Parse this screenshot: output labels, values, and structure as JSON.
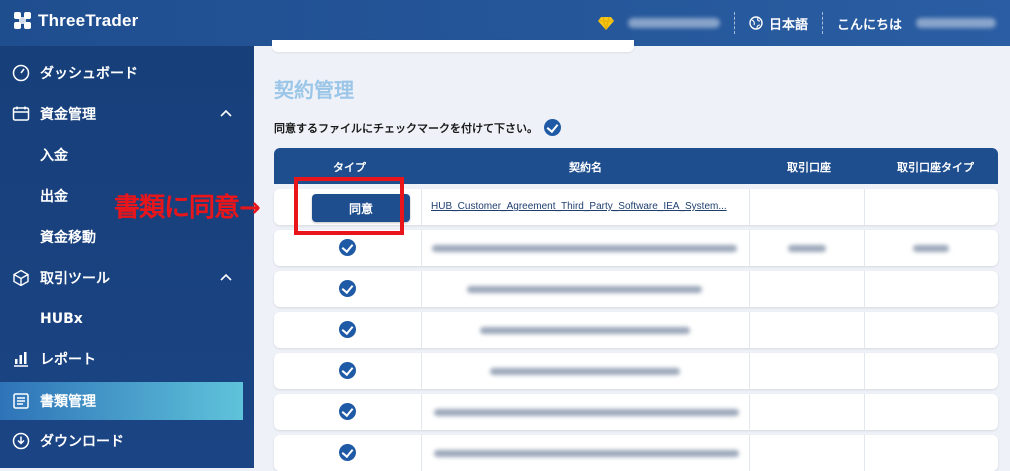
{
  "header": {
    "brand": "ThreeTrader",
    "language": "日本語",
    "greeting": "こんにちは"
  },
  "sidebar": {
    "items": [
      {
        "label": "ダッシュボード",
        "icon": "gauge-icon"
      },
      {
        "label": "資金管理",
        "icon": "wallet-icon",
        "expanded": true
      },
      {
        "label": "入金",
        "sub": true
      },
      {
        "label": "出金",
        "sub": true
      },
      {
        "label": "資金移動",
        "sub": true
      },
      {
        "label": "取引ツール",
        "icon": "cube-icon",
        "expanded": true
      },
      {
        "label": "HUBx",
        "sub": true
      },
      {
        "label": "レポート",
        "icon": "report-icon"
      },
      {
        "label": "書類管理",
        "icon": "document-icon",
        "active": true
      },
      {
        "label": "ダウンロード",
        "icon": "download-icon"
      }
    ]
  },
  "main": {
    "title": "契約管理",
    "instruction": "同意するファイルにチェックマークを付けて下さい。",
    "table": {
      "headers": [
        "タイプ",
        "契約名",
        "取引口座",
        "取引口座タイプ"
      ],
      "first_row": {
        "button": "同意",
        "doc": "HUB_Customer_Agreement_Third_Party_Software_IEA_System..."
      }
    },
    "annotation": "書類に同意→"
  },
  "colors": {
    "header_bg": "#1f4e8f",
    "sidebar_bg": "#173f7a",
    "accent": "#5fc3da",
    "annotation_red": "#e8151b",
    "title_light": "#9cc6e8"
  }
}
